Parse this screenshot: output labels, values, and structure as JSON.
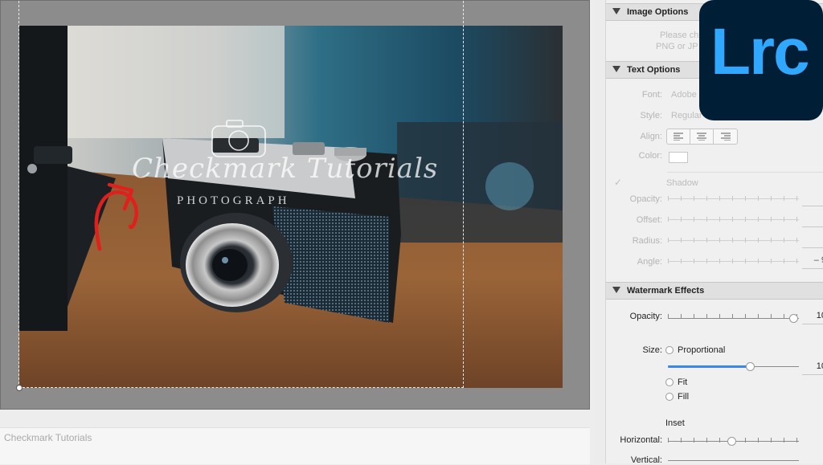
{
  "preview": {
    "watermark_text": "Checkmark Tutorials",
    "watermark_subtext": "PHOTOGRAPH",
    "caption": "Checkmark Tutorials"
  },
  "image_options": {
    "title": "Image Options",
    "hint_line1": "Please ch",
    "hint_line2": "PNG or JP"
  },
  "text_options": {
    "title": "Text Options",
    "font_label": "Font:",
    "font_value": "Adobe",
    "style_label": "Style:",
    "style_value": "Regular",
    "align_label": "Align:",
    "color_label": "Color:",
    "shadow_label": "Shadow",
    "opacity_label": "Opacity:",
    "offset_label": "Offset:",
    "radius_label": "Radius:",
    "angle_label": "Angle:",
    "angle_value": "– 9"
  },
  "watermark_effects": {
    "title": "Watermark Effects",
    "opacity_label": "Opacity:",
    "opacity_value": "10",
    "size_label": "Size:",
    "proportional_label": "Proportional",
    "size_value": "10",
    "fit_label": "Fit",
    "fill_label": "Fill",
    "inset_label": "Inset",
    "horizontal_label": "Horizontal:",
    "vertical_label": "Vertical:"
  },
  "badge": {
    "text": "Lrc"
  },
  "colors": {
    "accent": "#31a8ff",
    "badge_bg": "#001e36",
    "slider_fill": "#3a86ee",
    "annotation": "#e0201c"
  },
  "icons": {
    "collapse": "triangle-down-icon",
    "align": [
      "align-left-icon",
      "align-center-icon",
      "align-right-icon"
    ]
  }
}
